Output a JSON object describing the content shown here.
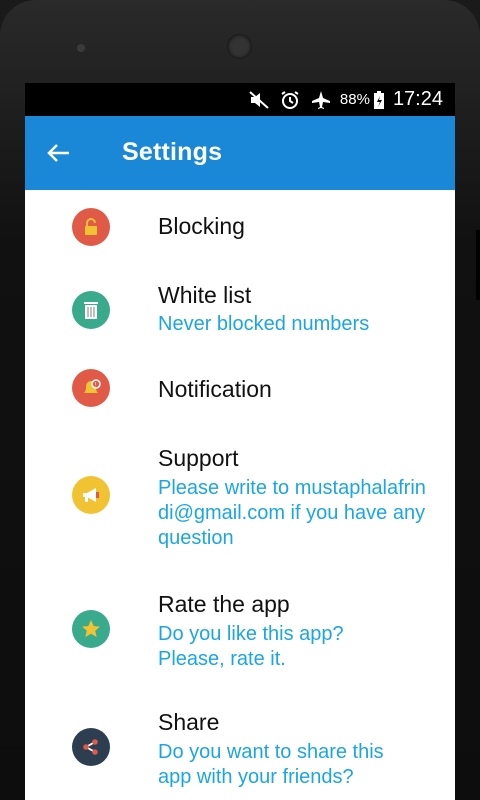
{
  "status": {
    "battery": "88%",
    "time": "17:24"
  },
  "appbar": {
    "title": "Settings"
  },
  "items": [
    {
      "title": "Blocking",
      "subtitle": "",
      "icon": "lock-icon",
      "color": "#e05a47"
    },
    {
      "title": "White list",
      "subtitle": "Never blocked numbers",
      "icon": "trash-icon",
      "color": "#3aaa8c"
    },
    {
      "title": "Notification",
      "subtitle": "",
      "icon": "bell-icon",
      "color": "#e05a47"
    },
    {
      "title": "Support",
      "subtitle": "Please write to mustaphalafrindi@gmail.com if you have any question",
      "icon": "megaphone-icon",
      "color": "#f1c232"
    },
    {
      "title": "Rate the app",
      "subtitle": "Do you like this app? Please, rate it.",
      "icon": "star-icon",
      "color": "#3aaa8c"
    },
    {
      "title": "Share",
      "subtitle": "Do you want to share this app with your friends?",
      "icon": "share-icon",
      "color": "#2d3e50"
    }
  ]
}
